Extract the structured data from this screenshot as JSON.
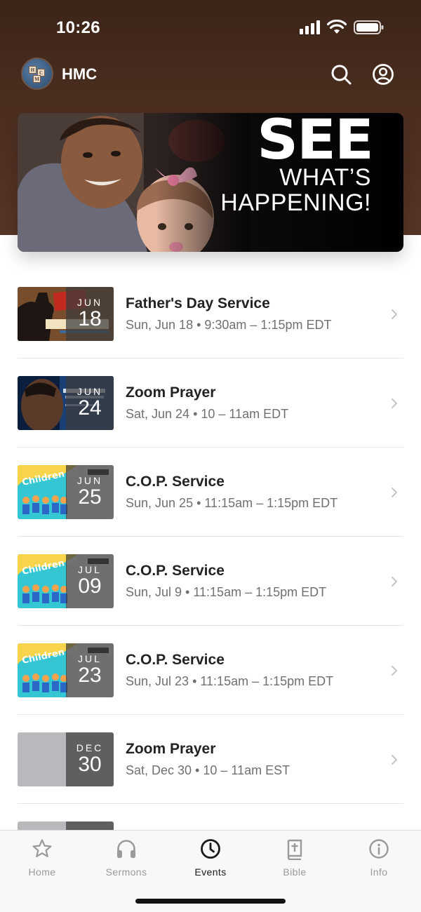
{
  "status": {
    "time": "10:26"
  },
  "header": {
    "brand": "HMC"
  },
  "banner": {
    "line1": "SEE",
    "line2": "WHAT’S",
    "line3": "HAPPENING!"
  },
  "events": [
    {
      "month": "JUN",
      "day": "18",
      "title": "Father's Day Service",
      "subtitle": "Sun, Jun 18 • 9:30am – 1:15pm EDT",
      "thumb": "fathers-day"
    },
    {
      "month": "JUN",
      "day": "24",
      "title": "Zoom Prayer",
      "subtitle": "Sat, Jun 24 • 10 – 11am EDT",
      "thumb": "zoom"
    },
    {
      "month": "JUN",
      "day": "25",
      "title": "C.O.P. Service",
      "subtitle": "Sun, Jun 25 • 11:15am – 1:15pm EDT",
      "thumb": "children"
    },
    {
      "month": "JUL",
      "day": "09",
      "title": "C.O.P. Service",
      "subtitle": "Sun, Jul 9 • 11:15am – 1:15pm EDT",
      "thumb": "children"
    },
    {
      "month": "JUL",
      "day": "23",
      "title": "C.O.P. Service",
      "subtitle": "Sun, Jul 23 • 11:15am – 1:15pm EDT",
      "thumb": "children"
    },
    {
      "month": "DEC",
      "day": "30",
      "title": "Zoom Prayer",
      "subtitle": "Sat, Dec 30 • 10 – 11am EST",
      "thumb": "blank"
    }
  ],
  "tabs": [
    {
      "label": "Home",
      "icon": "star-icon"
    },
    {
      "label": "Sermons",
      "icon": "headphones-icon"
    },
    {
      "label": "Events",
      "icon": "clock-icon",
      "active": true
    },
    {
      "label": "Bible",
      "icon": "bible-icon"
    },
    {
      "label": "Info",
      "icon": "info-icon"
    }
  ],
  "colors": {
    "header_brown": "#4b2e20",
    "text_dark": "#232323",
    "text_muted": "#707070",
    "tab_inactive": "#9a9a9a"
  }
}
